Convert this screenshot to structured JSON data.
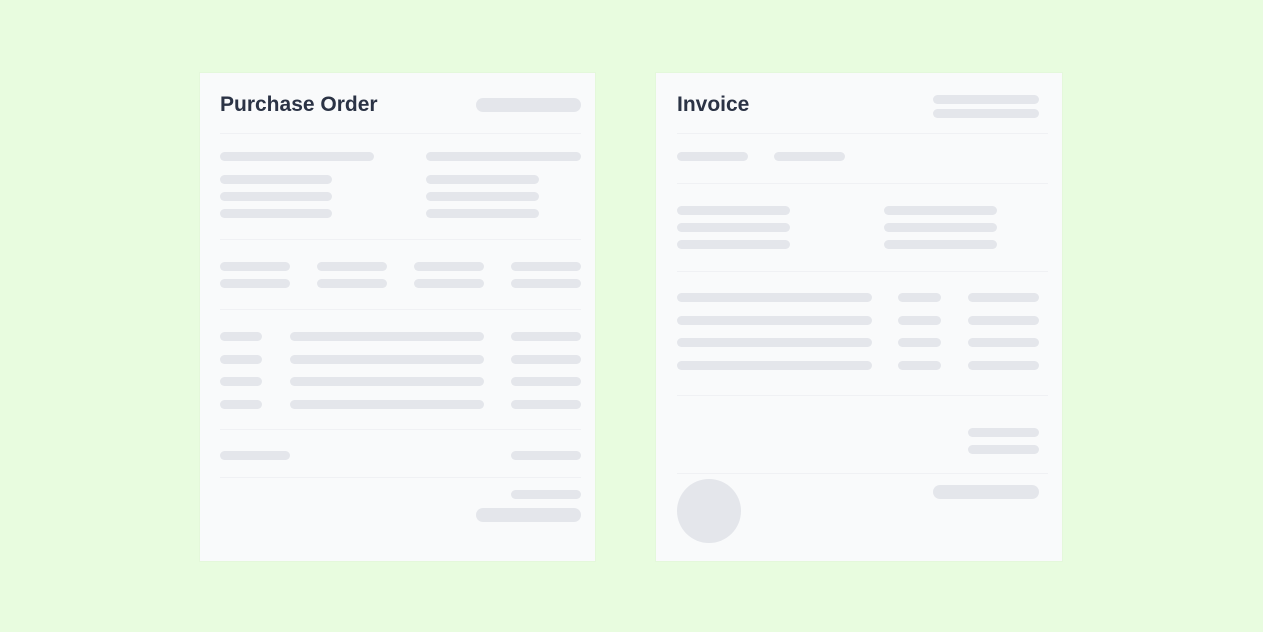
{
  "purchase_order": {
    "title": "Purchase Order"
  },
  "invoice": {
    "title": "Invoice"
  },
  "colors": {
    "background": "#e8fcdf",
    "card": "#f9fafb",
    "placeholder": "#e4e6eb",
    "title_text": "#2b3345"
  }
}
